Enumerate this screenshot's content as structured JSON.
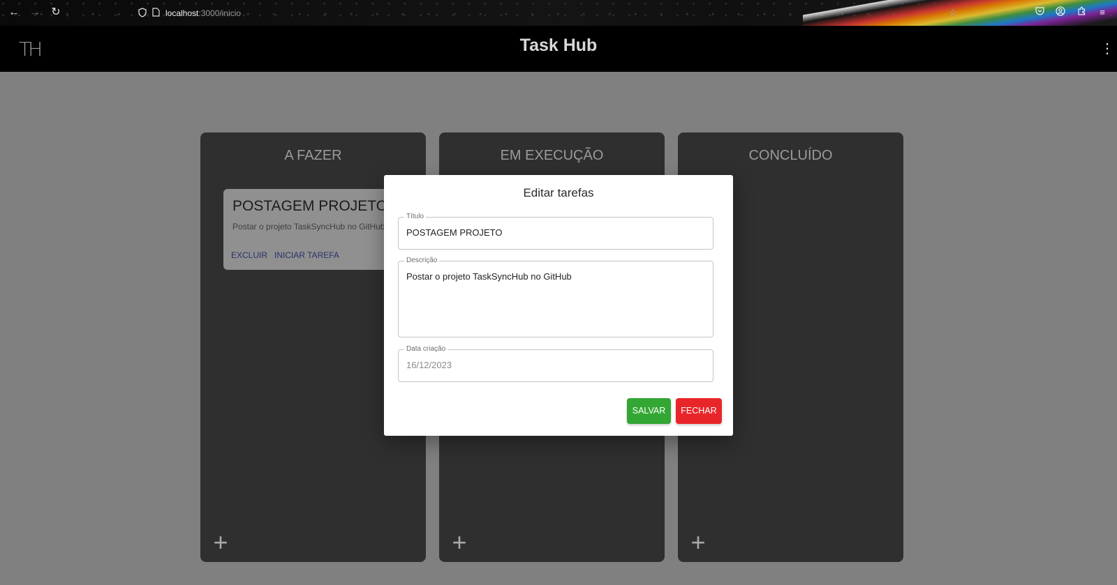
{
  "browser": {
    "url_host": "localhost",
    "url_path": ":3000/inicio"
  },
  "app": {
    "logo": "TH",
    "title": "Task Hub"
  },
  "columns": [
    {
      "title": "A FAZER"
    },
    {
      "title": "EM EXECUÇÃO"
    },
    {
      "title": "CONCLUÍDO"
    }
  ],
  "task_card": {
    "title": "POSTAGEM PROJETO",
    "description": "Postar o projeto TaskSyncHub no GitHub",
    "actions": [
      "EXCLUIR",
      "INICIAR TAREFA"
    ]
  },
  "modal": {
    "title": "Editar tarefas",
    "fields": {
      "title": {
        "label": "Título",
        "value": "POSTAGEM PROJETO"
      },
      "description": {
        "label": "Descrição",
        "value": "Postar o projeto TaskSyncHub no GitHub"
      },
      "created": {
        "label": "Data criação",
        "value": "16/12/2023"
      }
    },
    "save_label": "SALVAR",
    "close_label": "FECHAR"
  },
  "colors": {
    "save": "#33a733",
    "close": "#e8262a",
    "column_bg": "#2f2f2f",
    "page_bg": "#808080"
  },
  "icons": [
    "back-arrow-icon",
    "forward-arrow-icon",
    "reload-icon",
    "shield-icon",
    "page-icon",
    "star-icon",
    "pocket-icon",
    "account-icon",
    "extensions-icon",
    "hamburger-menu-icon",
    "kebab-menu-icon",
    "plus-icon"
  ]
}
